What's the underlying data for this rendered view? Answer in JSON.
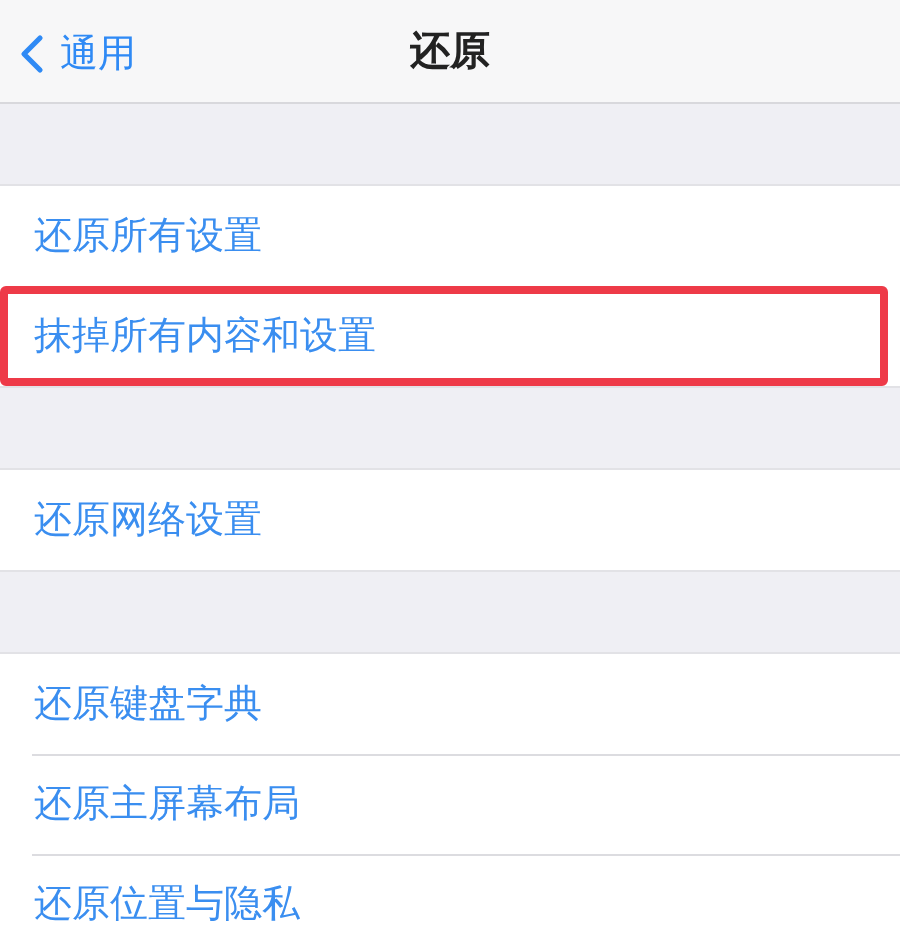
{
  "nav_bar": {
    "back_label": "通用",
    "title": "还原"
  },
  "groups": [
    {
      "items": [
        {
          "label": "还原所有设置",
          "highlighted": false
        },
        {
          "label": "抹掉所有内容和设置",
          "highlighted": true
        }
      ]
    },
    {
      "items": [
        {
          "label": "还原网络设置",
          "highlighted": false
        }
      ]
    },
    {
      "items": [
        {
          "label": "还原键盘字典",
          "highlighted": false
        },
        {
          "label": "还原主屏幕布局",
          "highlighted": false
        },
        {
          "label": "还原位置与隐私",
          "highlighted": false
        }
      ]
    }
  ]
}
